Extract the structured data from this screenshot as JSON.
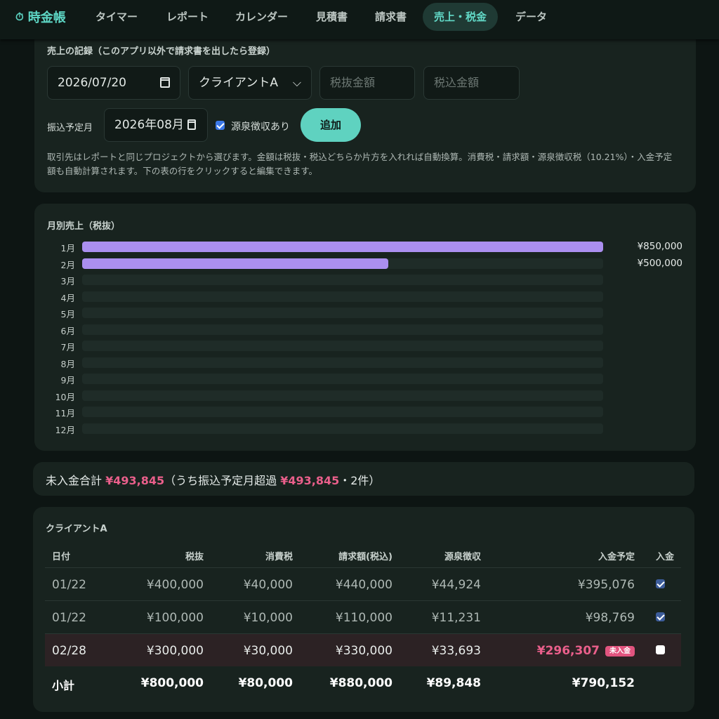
{
  "app": {
    "title": "時金帳",
    "icon": "stopwatch-icon"
  },
  "nav": {
    "tabs": [
      {
        "label": "タイマー"
      },
      {
        "label": "レポート"
      },
      {
        "label": "カレンダー"
      },
      {
        "label": "見積書"
      },
      {
        "label": "請求書"
      },
      {
        "label": "売上・税金",
        "active": true
      },
      {
        "label": "データ"
      }
    ]
  },
  "record": {
    "title": "売上の記録（このアプリ以外で請求書を出したら登録）",
    "date_value": "2026/07/20",
    "client_value": "クライアントA",
    "excl_placeholder": "税抜金額",
    "incl_placeholder": "税込金額",
    "transfer_label": "振込予定月",
    "transfer_value": "2026年08月",
    "withholding_label": "源泉徴収あり",
    "withholding_checked": true,
    "add_label": "追加",
    "help_text": "取引先はレポートと同じプロジェクトから選びます。金額は税抜・税込どちらか片方を入れれば自動換算。消費税・請求額・源泉徴収税（10.21%）・入金予定額も自動計算されます。下の表の行をクリックすると編集できます。"
  },
  "chart_data": {
    "type": "bar",
    "title": "月別売上（税抜）",
    "orientation": "horizontal",
    "categories": [
      "1月",
      "2月",
      "3月",
      "4月",
      "5月",
      "6月",
      "7月",
      "8月",
      "9月",
      "10月",
      "11月",
      "12月"
    ],
    "values": [
      850000,
      500000,
      0,
      0,
      0,
      0,
      0,
      0,
      0,
      0,
      0,
      0
    ],
    "value_labels": [
      "¥850,000",
      "¥500,000",
      "",
      "",
      "",
      "",
      "",
      "",
      "",
      "",
      "",
      ""
    ],
    "xlim": [
      0,
      850000
    ],
    "color": "#ab8ff0"
  },
  "summary": {
    "prefix": "未入金合計",
    "total": "¥493,845",
    "middle": "（うち振込予定月超過",
    "overdue": "¥493,845",
    "suffix": "・2件）"
  },
  "table": {
    "client": "クライアントA",
    "headers": [
      "日付",
      "税抜",
      "消費税",
      "請求額(税込)",
      "源泉徴収",
      "入金予定",
      "入金"
    ],
    "rows": [
      {
        "date": "01/22",
        "excl": "¥400,000",
        "tax": "¥40,000",
        "billed": "¥440,000",
        "withholding": "¥44,924",
        "expected": "¥395,076",
        "paid": true
      },
      {
        "date": "01/22",
        "excl": "¥100,000",
        "tax": "¥10,000",
        "billed": "¥110,000",
        "withholding": "¥11,231",
        "expected": "¥98,769",
        "paid": true
      },
      {
        "date": "02/28",
        "excl": "¥300,000",
        "tax": "¥30,000",
        "billed": "¥330,000",
        "withholding": "¥33,693",
        "expected": "¥296,307",
        "paid": false,
        "badge": "未入金"
      }
    ],
    "total": {
      "label": "小計",
      "excl": "¥800,000",
      "tax": "¥80,000",
      "billed": "¥880,000",
      "withholding": "¥89,848",
      "expected": "¥790,152"
    }
  },
  "colors": {
    "accent": "#5fd2c0",
    "bar": "#ab8ff0",
    "unpaid": "#ea5f8b"
  }
}
